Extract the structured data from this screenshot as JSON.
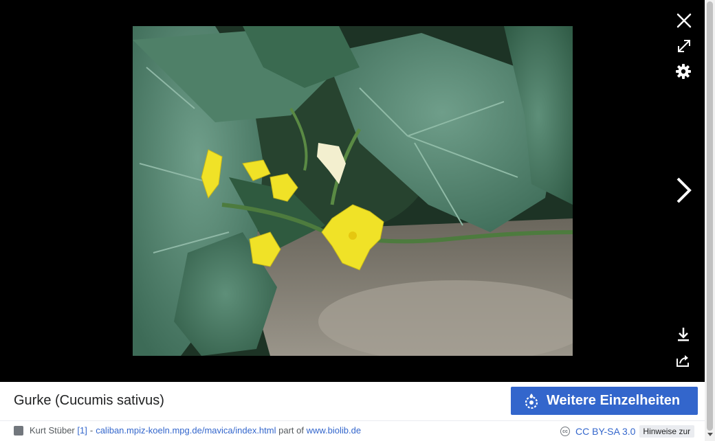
{
  "viewer": {
    "close_icon": "close-icon",
    "fullscreen_icon": "fullscreen-icon",
    "settings_icon": "gear-icon",
    "next_icon": "chevron-right-icon",
    "download_icon": "download-icon",
    "share_icon": "share-icon"
  },
  "image": {
    "subject": "cucumber plant with yellow flowers"
  },
  "info": {
    "title": "Gurke (Cucumis sativus)",
    "more_details_label": "Weitere Einzelheiten",
    "author": "Kurt Stüber",
    "ref_link": "[1]",
    "separator": "-",
    "source_link": "caliban.mpiz-koeln.mpg.de/mavica/index.html",
    "part_of": "part of",
    "biolib_link": "www.biolib.de",
    "license_link": "CC BY-SA 3.0",
    "usage_button": "Hinweise zur"
  },
  "colors": {
    "accent": "#3366cc",
    "background": "#000000"
  }
}
